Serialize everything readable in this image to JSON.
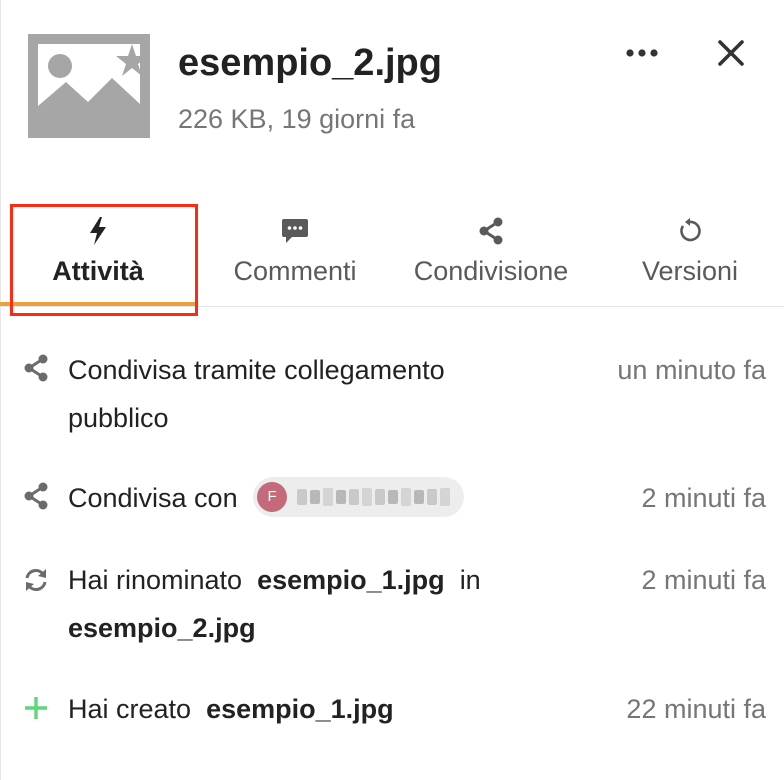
{
  "file": {
    "name": "esempio_2.jpg",
    "meta": "226 KB, 19 giorni fa",
    "thumbnail_icon": "image-placeholder-icon"
  },
  "header": {
    "more_icon": "more-horizontal-icon",
    "close_icon": "close-icon"
  },
  "tabs": [
    {
      "label": "Attività",
      "icon": "lightning-icon",
      "active": true
    },
    {
      "label": "Commenti",
      "icon": "comment-icon",
      "active": false
    },
    {
      "label": "Condivisione",
      "icon": "share-icon",
      "active": false
    },
    {
      "label": "Versioni",
      "icon": "history-icon",
      "active": false
    }
  ],
  "activities": [
    {
      "icon": "share-icon",
      "line1": "Condivisa tramite collegamento",
      "line2": "pubblico",
      "time": "un minuto fa"
    },
    {
      "icon": "share-icon",
      "prefix": "Condivisa con",
      "avatar_initial": "F",
      "time": "2 minuti fa"
    },
    {
      "icon": "rename-icon",
      "prefix": "Hai rinominato",
      "from": "esempio_1.jpg",
      "middle": "in",
      "to": "esempio_2.jpg",
      "time": "2 minuti fa"
    },
    {
      "icon": "plus-icon",
      "prefix": "Hai creato",
      "file": "esempio_1.jpg",
      "time": "22 minuti fa"
    }
  ],
  "colors": {
    "accent_underline": "#e9a23b",
    "highlight_box": "#ff2a14",
    "create_plus": "#5fd67a",
    "avatar": "#c46a7a"
  }
}
